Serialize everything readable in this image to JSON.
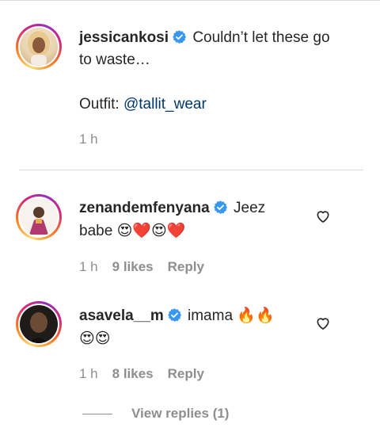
{
  "caption": {
    "username": "jessicankosi",
    "text": "Couldn’t let these go to waste…",
    "outfit_label": "Outfit:",
    "outfit_mention": "@tallit_wear",
    "time": "1 h"
  },
  "comments": [
    {
      "username": "zenandemfenyana",
      "text_first": "Jeez",
      "text_second": "babe",
      "emojis": "😍❤️😍❤️",
      "time": "1 h",
      "likes": "9 likes",
      "reply": "Reply"
    },
    {
      "username": "asavela__m",
      "text_first": "imama",
      "emojis_first": "🔥🔥",
      "emojis_second": "😍😍",
      "time": "1 h",
      "likes": "8 likes",
      "reply": "Reply"
    }
  ],
  "view_replies": "View replies (1)",
  "colors": {
    "verified": "#3897f0",
    "mention": "#00376b",
    "muted": "#8e8e8e",
    "text": "#262626"
  },
  "icons": {
    "verified": "verified-badge-icon",
    "like": "heart-outline-icon"
  }
}
